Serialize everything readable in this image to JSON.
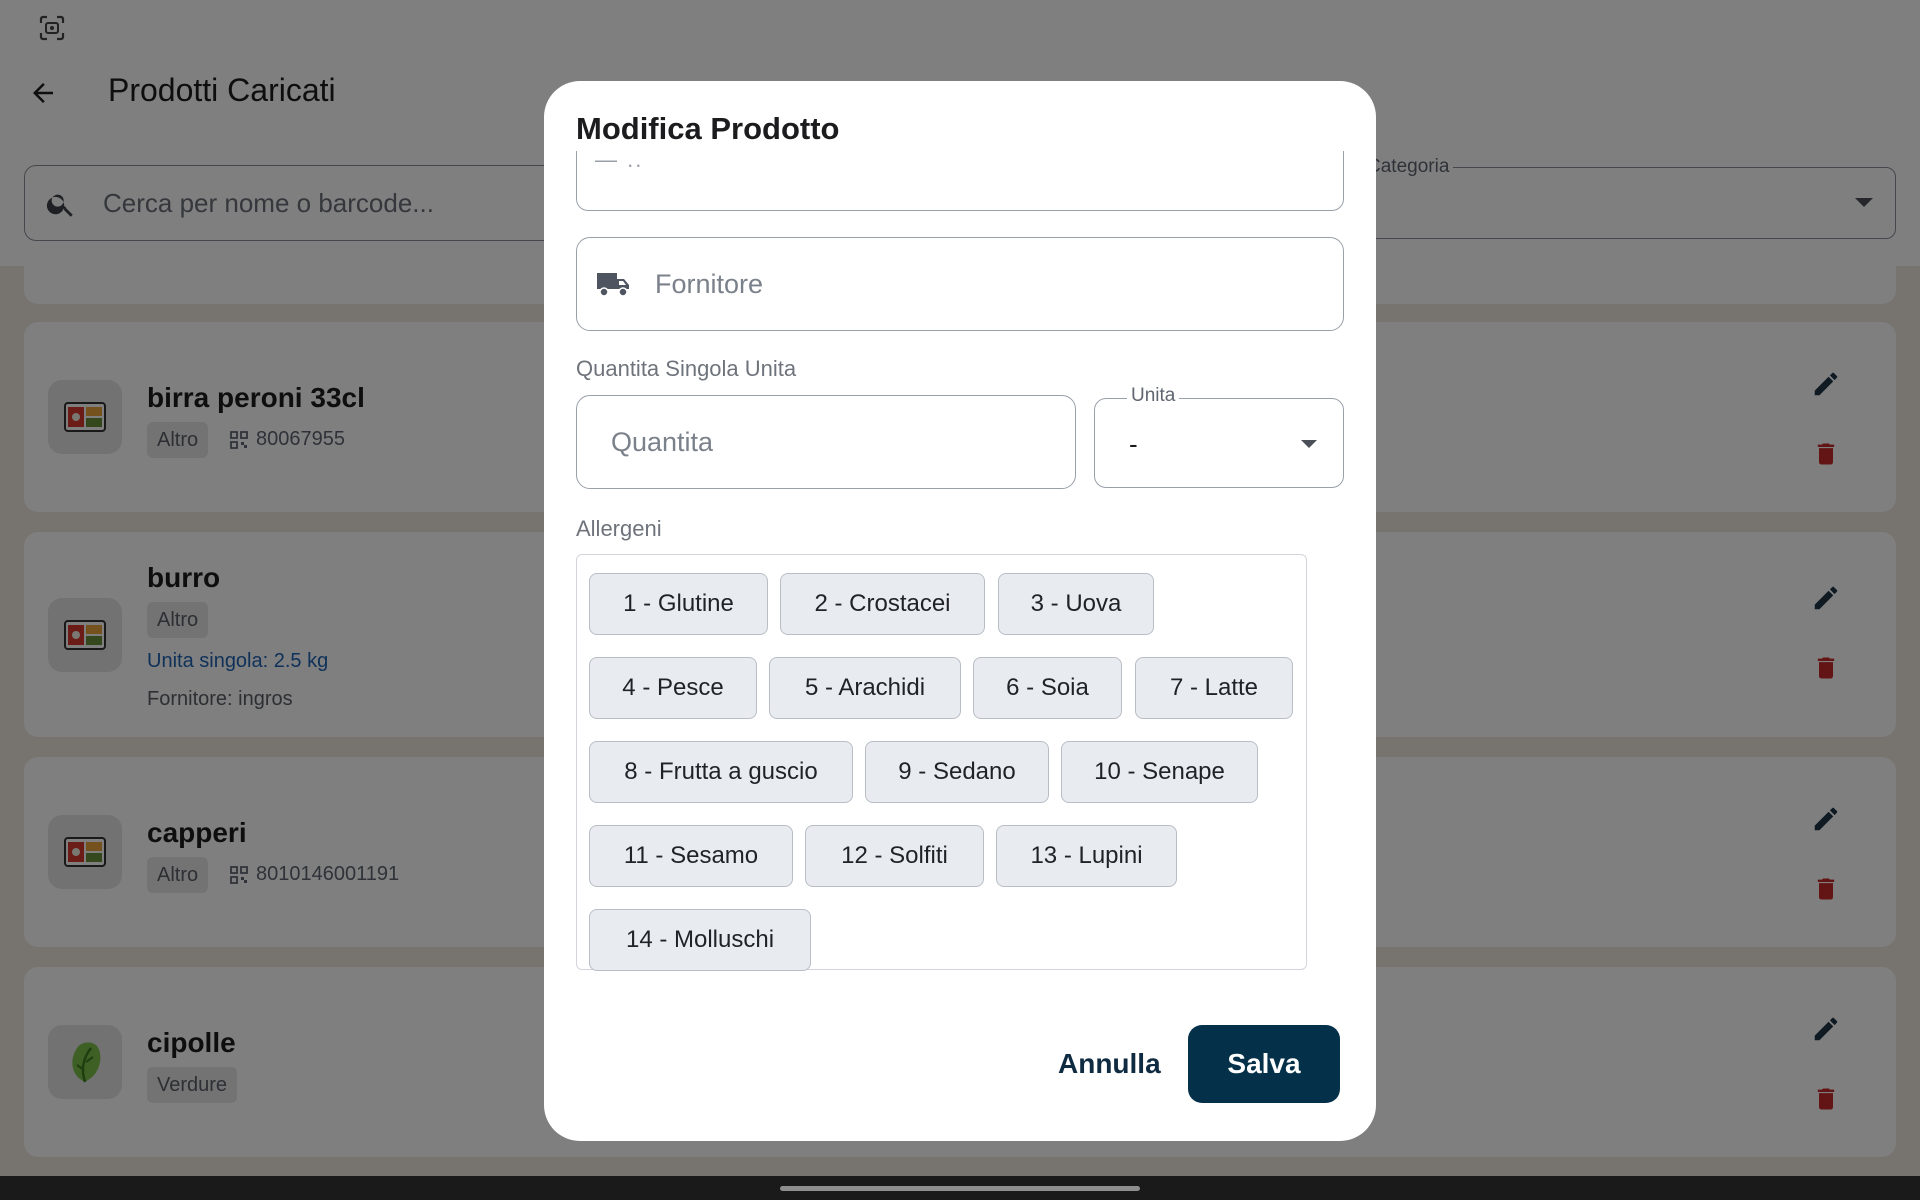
{
  "header": {
    "title": "Prodotti Caricati",
    "search_placeholder": "Cerca per nome o barcode...",
    "category_label": "Categoria"
  },
  "products": [
    {
      "name": "birra peroni 33cl",
      "category": "Altro",
      "barcode": "80067955",
      "image_icon": "bento-box-icon"
    },
    {
      "name": "burro",
      "category": "Altro",
      "unit_text": "Unita singola: 2.5 kg",
      "supplier_text": "Fornitore: ingros",
      "image_icon": "bento-box-icon"
    },
    {
      "name": "capperi",
      "category": "Altro",
      "barcode": "8010146001191",
      "image_icon": "bento-box-icon"
    },
    {
      "name": "cipolle",
      "category": "Verdure",
      "image_icon": "leafy-green-icon"
    }
  ],
  "dialog": {
    "title": "Modifica Prodotto",
    "clipped_field_text": "— ..",
    "supplier_placeholder": "Fornitore",
    "quantity_section_label": "Quantita Singola Unita",
    "quantity_placeholder": "Quantita",
    "unit_label": "Unita",
    "unit_value": "-",
    "allergens_label": "Allergeni",
    "allergens": [
      "1 - Glutine",
      "2 - Crostacei",
      "3 - Uova",
      "4 - Pesce",
      "5 - Arachidi",
      "6 - Soia",
      "7 - Latte",
      "8 - Frutta a guscio",
      "9 - Sedano",
      "10 - Senape",
      "11 - Sesamo",
      "12 - Solfiti",
      "13 - Lupini",
      "14 - Molluschi"
    ],
    "cancel_label": "Annulla",
    "save_label": "Salva"
  },
  "colors": {
    "primary": "#04304a",
    "delete": "#c62828",
    "link": "#1e63b4",
    "chip_bg": "#e8ebf0"
  }
}
